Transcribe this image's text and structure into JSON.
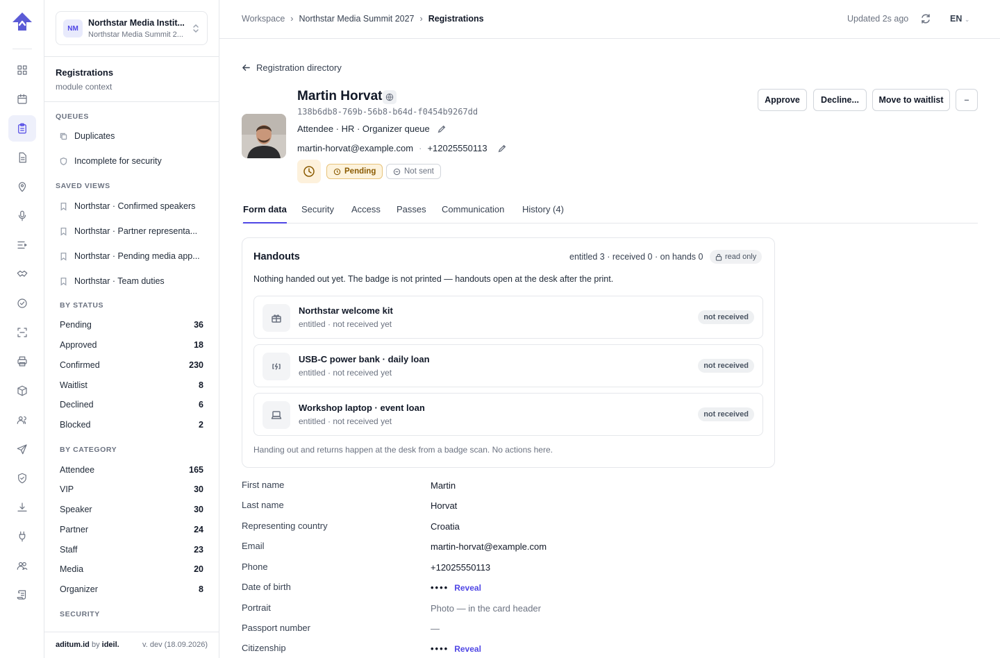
{
  "rail": {
    "items": [
      "dashboard-icon",
      "calendar-icon",
      "clipboard-icon",
      "document-icon",
      "location-pin-icon",
      "microphone-icon",
      "agenda-icon",
      "handshake-icon",
      "check-circle-icon",
      "scan-icon",
      "printer-icon",
      "package-icon",
      "users-icon",
      "send-icon",
      "shield-icon",
      "download-icon",
      "plug-icon",
      "team-icon",
      "scroll-icon"
    ],
    "active": "clipboard-icon"
  },
  "org": {
    "initials": "NM",
    "name": "Northstar Media Instit...",
    "sub": "Northstar Media Summit 2..."
  },
  "context": {
    "title": "Registrations",
    "sub": "module context"
  },
  "sidebar": {
    "queues_label": "QUEUES",
    "queues": [
      "Duplicates",
      "Incomplete for security"
    ],
    "saved_label": "SAVED VIEWS",
    "saved": [
      "Northstar · Confirmed speakers",
      "Northstar · Partner representa...",
      "Northstar · Pending media app...",
      "Northstar · Team duties"
    ],
    "status_label": "BY STATUS",
    "status": [
      {
        "label": "Pending",
        "count": "36"
      },
      {
        "label": "Approved",
        "count": "18"
      },
      {
        "label": "Confirmed",
        "count": "230"
      },
      {
        "label": "Waitlist",
        "count": "8"
      },
      {
        "label": "Declined",
        "count": "6"
      },
      {
        "label": "Blocked",
        "count": "2"
      }
    ],
    "category_label": "BY CATEGORY",
    "category": [
      {
        "label": "Attendee",
        "count": "165"
      },
      {
        "label": "VIP",
        "count": "30"
      },
      {
        "label": "Speaker",
        "count": "30"
      },
      {
        "label": "Partner",
        "count": "24"
      },
      {
        "label": "Staff",
        "count": "23"
      },
      {
        "label": "Media",
        "count": "20"
      },
      {
        "label": "Organizer",
        "count": "8"
      }
    ],
    "security_label": "SECURITY",
    "footer_brand": "aditum.id",
    "footer_by": "by",
    "footer_company": "ideil.",
    "footer_version": "v. dev (18.09.2026)"
  },
  "topbar": {
    "crumbs": [
      "Workspace",
      "Northstar Media Summit 2027",
      "Registrations"
    ],
    "updated": "Updated 2s ago",
    "lang": "EN"
  },
  "profile": {
    "back": "Registration directory",
    "name": "Martin Horvat",
    "uuid": "138b6db8-769b-56b8-b64d-f0454b9267dd",
    "meta": "Attendee · HR · Organizer queue",
    "email": "martin-horvat@example.com",
    "phone": "+12025550113",
    "status": "Pending",
    "notify": "Not sent"
  },
  "actions": {
    "approve": "Approve",
    "decline": "Decline...",
    "waitlist": "Move to waitlist",
    "more": "–"
  },
  "tabs": [
    "Form data",
    "Security",
    "Access",
    "Passes",
    "Communication",
    "History (4)"
  ],
  "handouts": {
    "title": "Handouts",
    "summary": "entitled 3 · received 0 · on hands 0",
    "readonly": "read only",
    "intro": "Nothing handed out yet. The badge is not printed — handouts open at the desk after the print.",
    "items": [
      {
        "name": "Northstar welcome kit",
        "status": "entitled · not received yet",
        "tag": "not received",
        "icon": "gift-icon"
      },
      {
        "name": "USB-C power bank · daily loan",
        "status": "entitled · not received yet",
        "tag": "not received",
        "icon": "battery-icon"
      },
      {
        "name": "Workshop laptop · event loan",
        "status": "entitled · not received yet",
        "tag": "not received",
        "icon": "laptop-icon"
      }
    ],
    "footer": "Handing out and returns happen at the desk from a badge scan. No actions here."
  },
  "fields": [
    {
      "label": "First name",
      "value": "Martin"
    },
    {
      "label": "Last name",
      "value": "Horvat"
    },
    {
      "label": "Representing country",
      "value": "Croatia"
    },
    {
      "label": "Email",
      "value": "martin-horvat@example.com"
    },
    {
      "label": "Phone",
      "value": "+12025550113"
    },
    {
      "label": "Date of birth",
      "value": "••••",
      "reveal": "Reveal"
    },
    {
      "label": "Portrait",
      "value": "Photo — in the card header"
    },
    {
      "label": "Passport number",
      "value": "—"
    },
    {
      "label": "Citizenship",
      "value": "••••",
      "reveal": "Reveal"
    }
  ],
  "colors": {
    "accent": "#4f46e5",
    "pending_bg": "#fdf3dd",
    "pending_text": "#8a5a00"
  }
}
